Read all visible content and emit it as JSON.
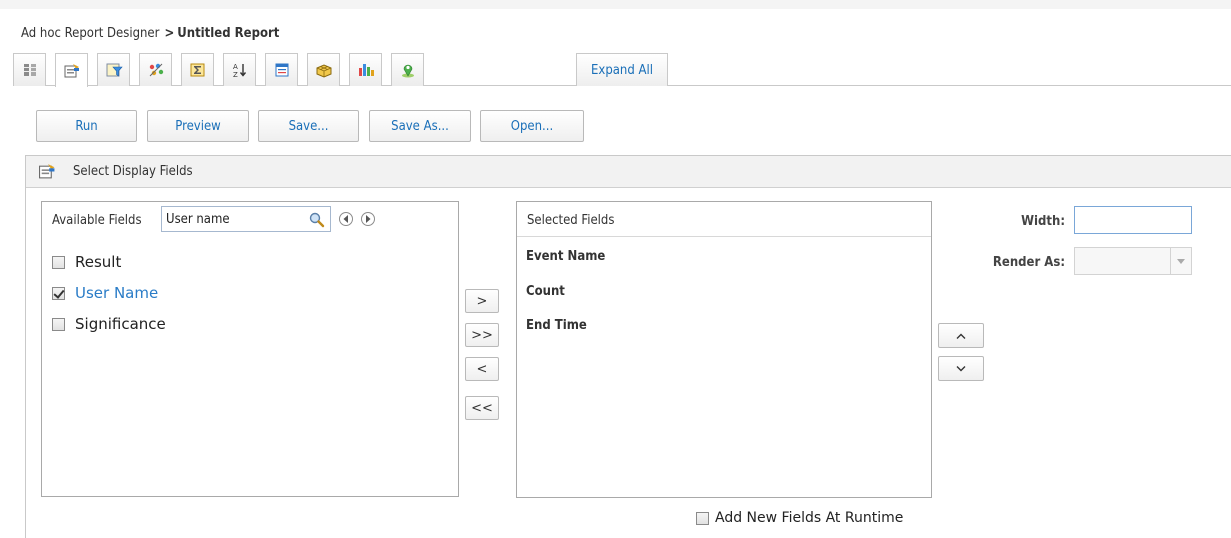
{
  "breadcrumb": {
    "parent": "Ad hoc Report Designer",
    "separator": ">",
    "current": "Untitled Report"
  },
  "tabs": [
    {
      "icon": "database-icon"
    },
    {
      "icon": "select-fields-icon",
      "active": true
    },
    {
      "icon": "filter-icon"
    },
    {
      "icon": "group-icon"
    },
    {
      "icon": "summary-sigma-icon"
    },
    {
      "icon": "sort-icon"
    },
    {
      "icon": "format-icon"
    },
    {
      "icon": "pivot-table-icon"
    },
    {
      "icon": "chart-icon"
    },
    {
      "icon": "map-pin-icon"
    }
  ],
  "expand_all": "Expand All",
  "toolbar": {
    "run": "Run",
    "preview": "Preview",
    "save": "Save...",
    "save_as": "Save As...",
    "open": "Open..."
  },
  "section": {
    "title": "Select Display Fields"
  },
  "available": {
    "label": "Available Fields",
    "search_value": "User name",
    "fields": [
      {
        "label": "Result",
        "checked": false
      },
      {
        "label": "User Name",
        "checked": true
      },
      {
        "label": "Significance",
        "checked": false
      }
    ]
  },
  "move_buttons": {
    "add": ">",
    "add_all": ">>",
    "remove": "<",
    "remove_all": "<<"
  },
  "selected": {
    "label": "Selected Fields",
    "fields": [
      "Event Name",
      "Count",
      "End Time"
    ]
  },
  "order_buttons": {
    "up": "^",
    "down": "v"
  },
  "properties": {
    "width_label": "Width:",
    "width_value": "",
    "render_label": "Render As:",
    "render_value": ""
  },
  "runtime": {
    "label": "Add New Fields At Runtime",
    "checked": false
  }
}
